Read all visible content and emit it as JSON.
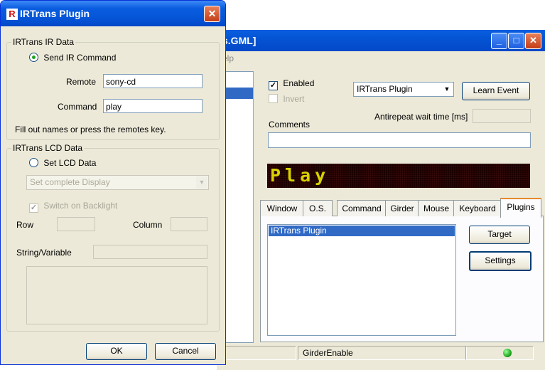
{
  "main_window": {
    "title": "s.GML]",
    "menu_fragment": "elp",
    "controls": {
      "minimize": "_",
      "maximize": "□",
      "close": "✕"
    },
    "enabled": {
      "label": "Enabled",
      "checked": true
    },
    "invert": {
      "label": "Invert",
      "checked": false
    },
    "plugin_select": "IRTrans Plugin",
    "learn_event_button": "Learn Event",
    "antirepeat_label": "Antirepeat wait time [ms]",
    "antirepeat_value": "",
    "comments_label": "Comments",
    "comments_value": "",
    "led_display_text": "Play",
    "tabs": [
      {
        "label": "Window"
      },
      {
        "label": "O.S."
      },
      {
        "label": "Command"
      },
      {
        "label": "Girder"
      },
      {
        "label": "Mouse"
      },
      {
        "label": "Keyboard"
      },
      {
        "label": "Plugins"
      }
    ],
    "active_tab": "Plugins",
    "plugins_list": [
      "IRTrans Plugin"
    ],
    "target_button": "Target",
    "settings_button": "Settings",
    "statusbar_text": "GirderEnable"
  },
  "dialog": {
    "title": "IRTrans Plugin",
    "logo": "R",
    "close": "✕",
    "ir_group": {
      "legend": "IRTrans IR Data",
      "send_label": "Send IR Command",
      "remote_label": "Remote",
      "remote_value": "sony-cd",
      "command_label": "Command",
      "command_value": "play",
      "hint": "Fill out names or press the remotes key."
    },
    "lcd_group": {
      "legend": "IRTrans LCD Data",
      "set_lcd_label": "Set LCD Data",
      "mode_select": "Set complete Display",
      "backlight_label": "Switch on Backlight",
      "row_label": "Row",
      "column_label": "Column",
      "string_label": "String/Variable"
    },
    "ok_button": "OK",
    "cancel_button": "Cancel"
  },
  "colors": {
    "titlebar": "#0554d6",
    "selection": "#316ac5",
    "led_text": "#d8d200",
    "status_led": "#22aa22"
  }
}
